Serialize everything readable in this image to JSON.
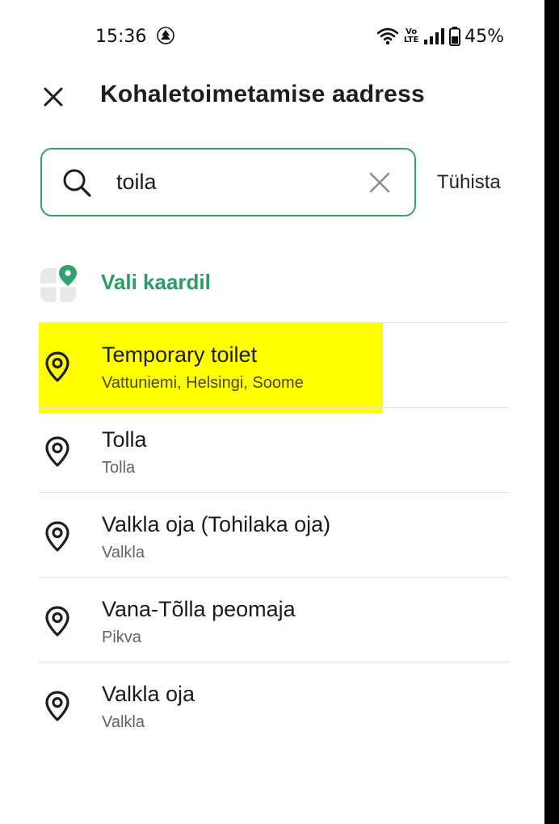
{
  "status_bar": {
    "time": "15:36",
    "volte": "Vo LTE",
    "battery": "45%"
  },
  "header": {
    "title": "Kohaletoimetamise aadress",
    "close_icon": "close-icon"
  },
  "search": {
    "value": "toila",
    "cancel_label": "Tühista",
    "accent_color": "#2fa36b"
  },
  "map_option": {
    "label": "Vali kaardil",
    "color": "#2a9d64"
  },
  "results": [
    {
      "title": "Temporary toilet",
      "subtitle": "Vattuniemi, Helsingi, Soome",
      "highlighted": true
    },
    {
      "title": "Tolla",
      "subtitle": "Tolla",
      "highlighted": false
    },
    {
      "title": "Valkla oja (Tohilaka oja)",
      "subtitle": "Valkla",
      "highlighted": false
    },
    {
      "title": "Vana-Tõlla peomaja",
      "subtitle": "Pikva",
      "highlighted": false
    },
    {
      "title": "Valkla oja",
      "subtitle": "Valkla",
      "highlighted": false
    }
  ],
  "highlight_color": "#ffff00"
}
